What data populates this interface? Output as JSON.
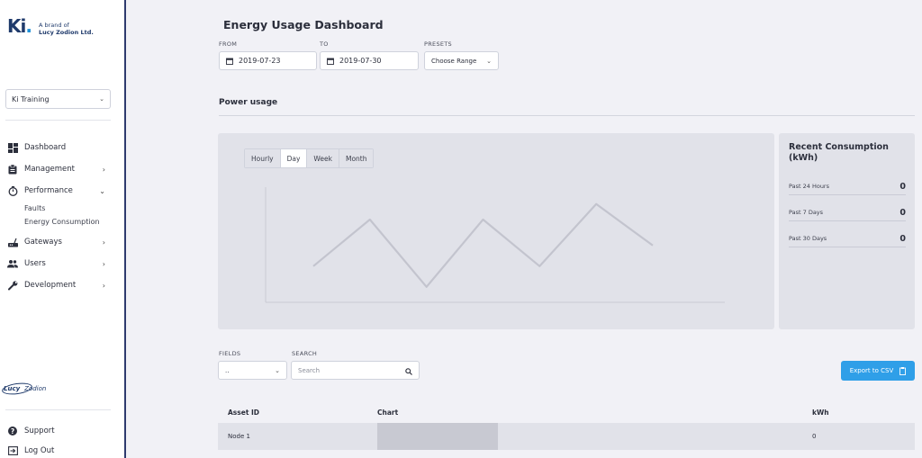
{
  "brand": {
    "logo": "Ki",
    "dot": ".",
    "line1": "A brand of",
    "line2": "Lucy Zodion Ltd."
  },
  "org_select": {
    "value": "Ki Training"
  },
  "nav": {
    "dashboard": "Dashboard",
    "management": "Management",
    "performance": "Performance",
    "faults": "Faults",
    "energy": "Energy Consumption",
    "gateways": "Gateways",
    "users": "Users",
    "development": "Development"
  },
  "footer_logo": {
    "lucy": "Lucy",
    "zodion": "Zodion"
  },
  "footer": {
    "support": "Support",
    "logout": "Log Out"
  },
  "page": {
    "title": "Energy Usage Dashboard"
  },
  "filters": {
    "from_label": "FROM",
    "from_value": "2019-07-23",
    "to_label": "TO",
    "to_value": "2019-07-30",
    "presets_label": "PRESETS",
    "presets_value": "Choose Range"
  },
  "section": {
    "title": "Power usage"
  },
  "chart": {
    "tabs": [
      "Hourly",
      "Day",
      "Week",
      "Month"
    ],
    "active_tab": "Day"
  },
  "chart_data": {
    "type": "line",
    "title": "",
    "xlabel": "",
    "ylabel": "",
    "x": [
      1,
      2,
      3,
      4,
      5,
      6,
      7
    ],
    "series": [
      {
        "values": [
          0.35,
          0.8,
          0.15,
          0.8,
          0.35,
          0.95,
          0.55
        ]
      }
    ],
    "ylim": [
      0,
      1.2
    ],
    "grid": false
  },
  "consumption": {
    "title": "Recent Consumption (kWh)",
    "rows": [
      {
        "label": "Past 24 Hours",
        "value": "0"
      },
      {
        "label": "Past 7 Days",
        "value": "0"
      },
      {
        "label": "Past 30 Days",
        "value": "0"
      }
    ]
  },
  "table_controls": {
    "fields_label": "FIELDS",
    "fields_value": "..",
    "search_label": "SEARCH",
    "search_placeholder": "Search",
    "export_label": "Export to CSV"
  },
  "table": {
    "headers": {
      "asset": "Asset ID",
      "chart": "Chart",
      "kwh": "kWh"
    },
    "rows": [
      {
        "asset": "Node 1",
        "kwh": "0"
      }
    ]
  },
  "colors": {
    "accent": "#2f9fe8",
    "sidebar_border": "#2e3a6e",
    "brand": "#1f3a6b",
    "line": "#c3c4ce"
  }
}
